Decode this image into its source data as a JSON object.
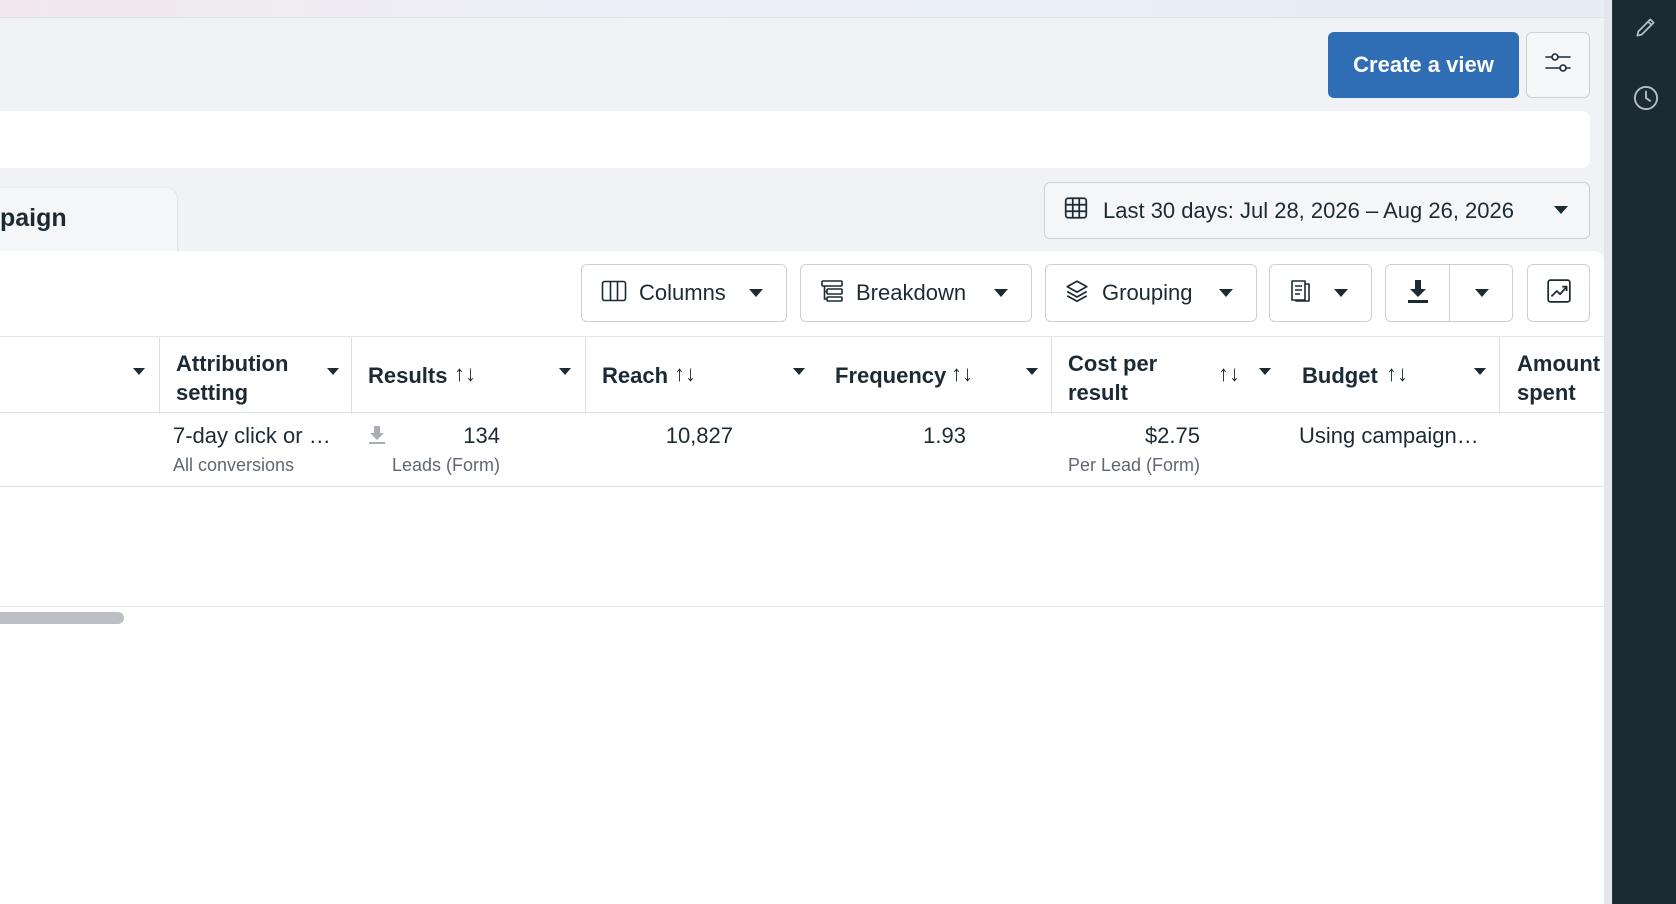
{
  "header": {
    "create_view_label": "Create a view"
  },
  "tabs": {
    "campaign_label": "paign"
  },
  "date_range": {
    "label": "Last 30 days: Jul 28, 2026 – Aug 26, 2026"
  },
  "toolbar": {
    "columns_label": "Columns",
    "breakdown_label": "Breakdown",
    "grouping_label": "Grouping"
  },
  "table": {
    "headers": {
      "attribution_line1": "Attribution",
      "attribution_line2": "setting",
      "results": "Results",
      "reach": "Reach",
      "frequency": "Frequency",
      "cost_line1": "Cost per",
      "cost_line2": "result",
      "budget": "Budget",
      "amount_line1": "Amount",
      "amount_line2": "spent",
      "sort_glyph": "↑↓"
    },
    "row": {
      "attribution_value": "7-day click or …",
      "attribution_sub": "All conversions",
      "results_value": "134",
      "results_sub": "Leads (Form)",
      "reach_value": "10,827",
      "frequency_value": "1.93",
      "cost_value": "$2.75",
      "cost_sub": "Per Lead (Form)",
      "budget_value": "Using campaign…"
    }
  },
  "colors": {
    "primary": "#2f6db5",
    "rail": "#1c2b33"
  }
}
